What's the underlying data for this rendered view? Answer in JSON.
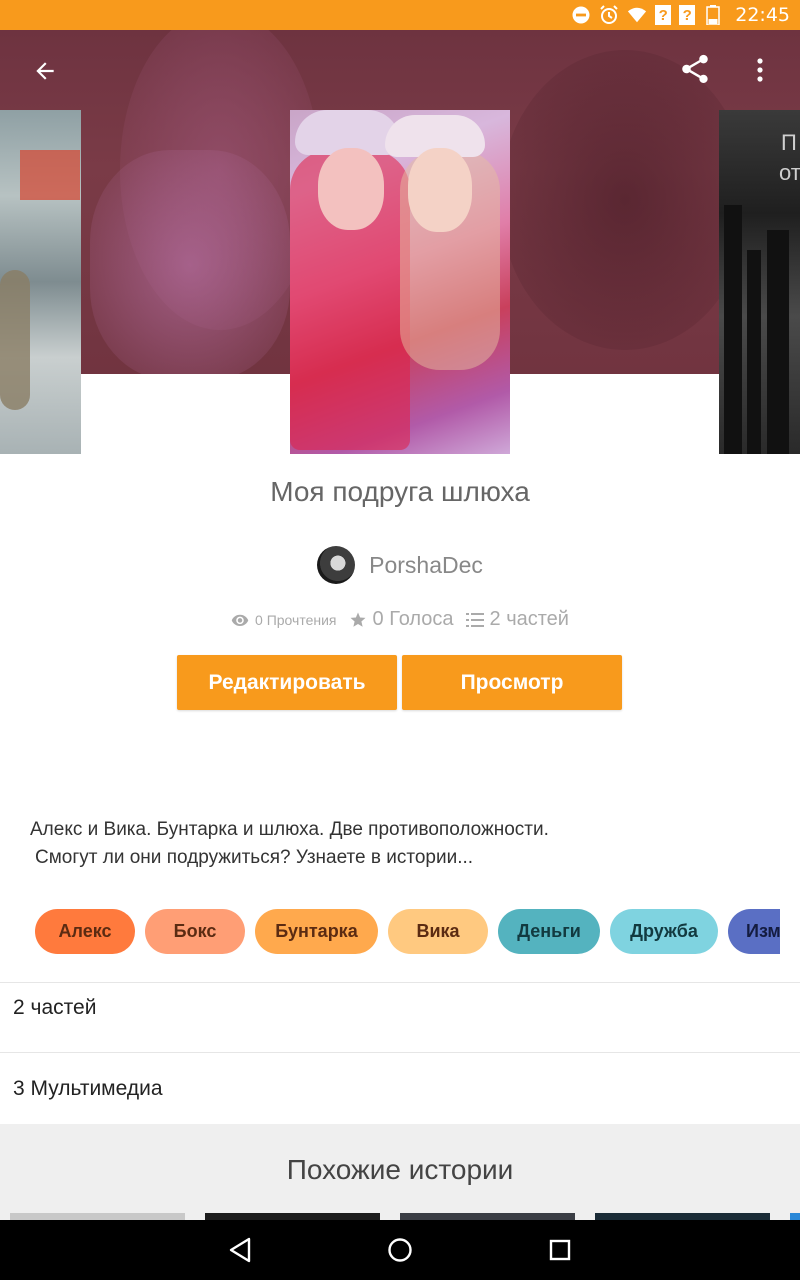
{
  "status_bar": {
    "time": "22:45",
    "icons": [
      "do-not-disturb-icon",
      "alarm-icon",
      "wifi-icon",
      "signal-unknown-icon",
      "signal-unknown-icon",
      "battery-icon"
    ],
    "unknown_signal_glyph": "?"
  },
  "toolbar": {
    "back_icon": "arrow-back-icon",
    "share_icon": "share-icon",
    "more_icon": "more-vert-icon"
  },
  "story": {
    "title": "Моя подруга шлюха",
    "author": "PorshaDec",
    "reads": "0 Прочтения",
    "votes": "0 Голоса",
    "parts": "2 частей",
    "edit_label": "Редактировать",
    "view_label": "Просмотр",
    "description_line1": "Алекс и Вика. Бунтарка и шлюха. Две противоположности.",
    "description_line2": "Смогут ли они подружиться? Узнаете в истории..."
  },
  "right_cover_text": {
    "line1": "П",
    "line2": "от"
  },
  "tags": [
    {
      "label": "Алекс",
      "color": "#ff7a3d"
    },
    {
      "label": "Бокс",
      "color": "#ff9e75"
    },
    {
      "label": "Бунтарка",
      "color": "#ffa94d"
    },
    {
      "label": "Вика",
      "color": "#ffc980"
    },
    {
      "label": "Деньги",
      "color": "#54b3bf"
    },
    {
      "label": "Дружба",
      "color": "#7fd3e0"
    },
    {
      "label": "Изм",
      "color": "#5a6fc4"
    }
  ],
  "sections": {
    "parts_label": "2 частей",
    "media_label": "3 Мультимедиа"
  },
  "similar": {
    "title": "Похожие истории"
  },
  "colors": {
    "accent": "#f89a1c",
    "status_bar": "#f89a1c",
    "hero_bg": "#713440"
  },
  "nav": {
    "back_icon": "nav-back-icon",
    "home_icon": "nav-home-icon",
    "recents_icon": "nav-recents-icon"
  }
}
